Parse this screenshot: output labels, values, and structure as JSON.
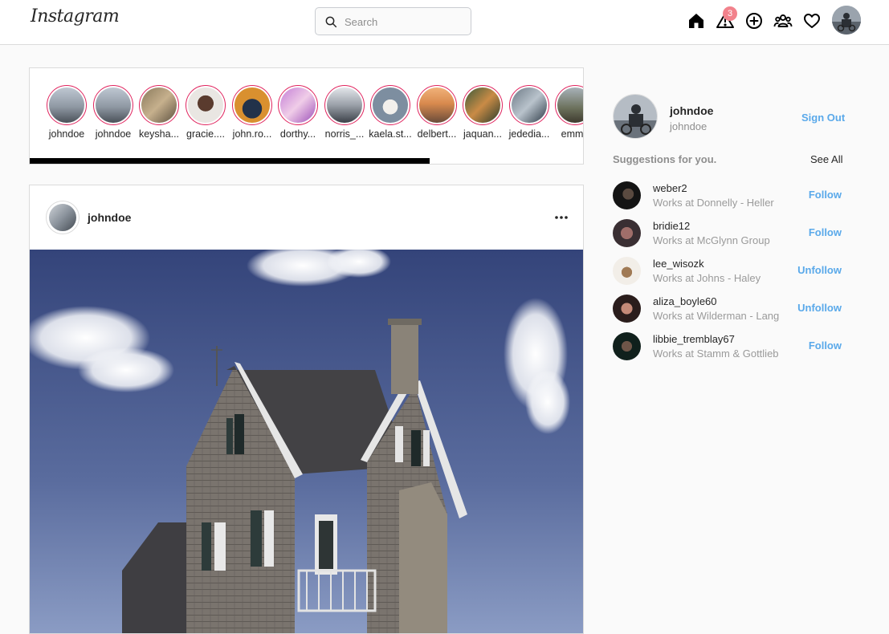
{
  "nav": {
    "logo": "Instagram",
    "search_placeholder": "Search",
    "notification_count": "3",
    "icons": [
      "home-icon",
      "notifications-icon",
      "add-post-icon",
      "people-icon",
      "heart-icon"
    ]
  },
  "stories": {
    "items": [
      {
        "name": "johndoe"
      },
      {
        "name": "johndoe"
      },
      {
        "name": "keysha..."
      },
      {
        "name": "gracie...."
      },
      {
        "name": "john.ro..."
      },
      {
        "name": "dorthy..."
      },
      {
        "name": "norris_..."
      },
      {
        "name": "kaela.st..."
      },
      {
        "name": "delbert..."
      },
      {
        "name": "jaquan..."
      },
      {
        "name": "jededia..."
      },
      {
        "name": "emme"
      }
    ],
    "ring_color": "#e0245e",
    "scroll_fraction": 0.72
  },
  "post": {
    "username": "johndoe",
    "more_icon": "more-horizontal-icon"
  },
  "sidebar": {
    "username": "johndoe",
    "fullname": "johndoe",
    "sign_out_label": "Sign Out",
    "suggestions_title": "Suggestions for you.",
    "see_all_label": "See All",
    "suggestions": [
      {
        "username": "weber2",
        "subtitle": "Works at Donnelly - Heller",
        "action": "Follow"
      },
      {
        "username": "bridie12",
        "subtitle": "Works at McGlynn Group",
        "action": "Follow"
      },
      {
        "username": "lee_wisozk",
        "subtitle": "Works at Johns - Haley",
        "action": "Unfollow"
      },
      {
        "username": "aliza_boyle60",
        "subtitle": "Works at Wilderman - Lang",
        "action": "Unfollow"
      },
      {
        "username": "libbie_tremblay67",
        "subtitle": "Works at Stamm & Gottlieb",
        "action": "Follow"
      }
    ]
  },
  "colors": {
    "accent_blue": "#5aa9ea",
    "badge": "#f2828c",
    "border": "#dbdbdb"
  }
}
